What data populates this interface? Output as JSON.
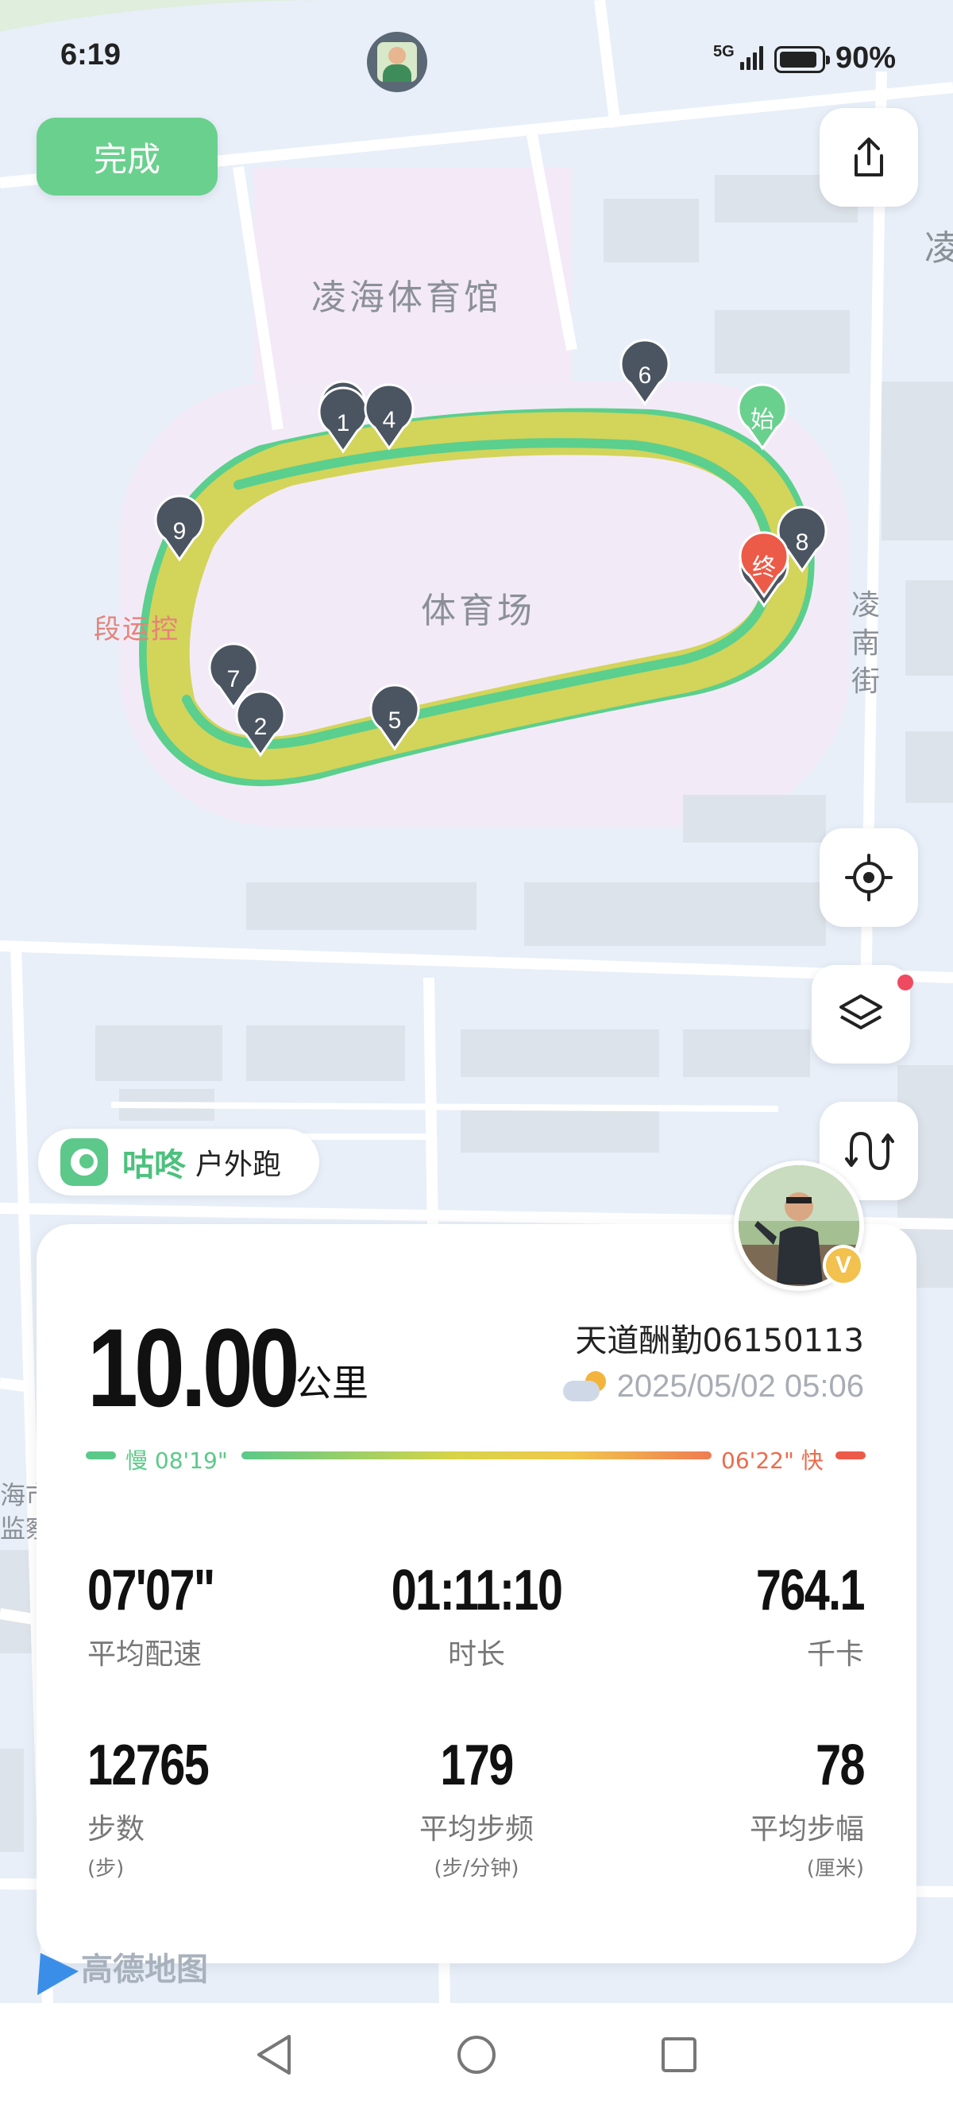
{
  "status_bar": {
    "time": "6:19",
    "network": "5G",
    "battery": "90%"
  },
  "toolbar": {
    "done_label": "完成"
  },
  "map": {
    "labels": {
      "gym": "凌海体育馆",
      "stadium": "体育场",
      "street": "凌南街",
      "street_cut": "凌",
      "poi": "段运控",
      "poi2_line1": "海市",
      "poi2_line2": "监察"
    },
    "markers": [
      "1",
      "2",
      "4",
      "5",
      "6",
      "7",
      "8",
      "9"
    ],
    "start_label": "始",
    "end_label": "终",
    "icons": [
      "share-icon",
      "locate-icon",
      "layers-icon",
      "route-icon"
    ],
    "colors": {
      "route_slow": "#5bcf8d",
      "route_fast": "#d3d45a",
      "marker": "#4b5561",
      "start": "#6ad08e",
      "end": "#ec5a48"
    }
  },
  "app": {
    "name": "咕咚",
    "activity": "户外跑"
  },
  "summary": {
    "distance": "10.00",
    "distance_unit": "公里",
    "username": "天道酬勤06150113",
    "date": "2025/05/02 05:06",
    "pace_slow": "慢 08'19\"",
    "pace_fast": "06'22\" 快",
    "avatar_badge": "V"
  },
  "stats": [
    {
      "value": "07'07\"",
      "label": "平均配速",
      "sub": ""
    },
    {
      "value": "01:11:10",
      "label": "时长",
      "sub": ""
    },
    {
      "value": "764.1",
      "label": "千卡",
      "sub": ""
    },
    {
      "value": "12765",
      "label": "步数",
      "sub": "(步)"
    },
    {
      "value": "179",
      "label": "平均步频",
      "sub": "(步/分钟)"
    },
    {
      "value": "78",
      "label": "平均步幅",
      "sub": "(厘米)"
    }
  ],
  "map_provider": "高德地图"
}
